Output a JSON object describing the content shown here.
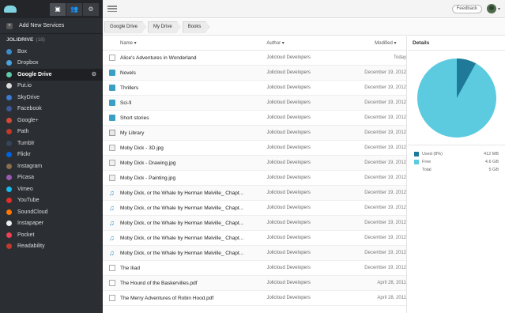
{
  "sidebar": {
    "add_services": "Add New Services",
    "section_title": "JOLIDRIVE",
    "section_count": "(18)",
    "items": [
      {
        "label": "Box",
        "icon": "box-icon",
        "color": "#3b8ec9"
      },
      {
        "label": "Dropbox",
        "icon": "dropbox-icon",
        "color": "#4aa3df"
      },
      {
        "label": "Google Drive",
        "icon": "google-drive-icon",
        "color": "#5fc9a7",
        "active": true
      },
      {
        "label": "Put.io",
        "icon": "putio-icon",
        "color": "#dddddd"
      },
      {
        "label": "SkyDrive",
        "icon": "skydrive-icon",
        "color": "#3a7bd5"
      },
      {
        "label": "Facebook",
        "icon": "facebook-icon",
        "color": "#3b5998"
      },
      {
        "label": "Google+",
        "icon": "google-plus-icon",
        "color": "#d34836"
      },
      {
        "label": "Path",
        "icon": "path-icon",
        "color": "#c0392b"
      },
      {
        "label": "Tumblr",
        "icon": "tumblr-icon",
        "color": "#35465c"
      },
      {
        "label": "Flickr",
        "icon": "flickr-icon",
        "color": "#0063dc"
      },
      {
        "label": "Instagram",
        "icon": "instagram-icon",
        "color": "#8a6d4b"
      },
      {
        "label": "Picasa",
        "icon": "picasa-icon",
        "color": "#9b59b6"
      },
      {
        "label": "Vimeo",
        "icon": "vimeo-icon",
        "color": "#1ab7ea"
      },
      {
        "label": "YouTube",
        "icon": "youtube-icon",
        "color": "#e52d27"
      },
      {
        "label": "SoundCloud",
        "icon": "soundcloud-icon",
        "color": "#ff7700"
      },
      {
        "label": "Instapaper",
        "icon": "instapaper-icon",
        "color": "#eeeeee"
      },
      {
        "label": "Pocket",
        "icon": "pocket-icon",
        "color": "#ee4056"
      },
      {
        "label": "Readability",
        "icon": "readability-icon",
        "color": "#c0392b"
      }
    ]
  },
  "topbar": {
    "feedback": "Feedback"
  },
  "breadcrumb": [
    "Google Drive",
    "My Drive",
    "Books"
  ],
  "columns": {
    "name": "Name",
    "author": "Author",
    "modified": "Modified"
  },
  "files": [
    {
      "type": "file",
      "name": "Alice's Adventures in Wonderland",
      "author": "Jolicloud Developers",
      "modified": "Today"
    },
    {
      "type": "folder",
      "name": "Novels",
      "author": "Jolicloud Developers",
      "modified": "December 19, 2012"
    },
    {
      "type": "folder",
      "name": "Thrillers",
      "author": "Jolicloud Developers",
      "modified": "December 19, 2012"
    },
    {
      "type": "folder",
      "name": "Sci-fi",
      "author": "Jolicloud Developers",
      "modified": "December 19, 2012"
    },
    {
      "type": "folder",
      "name": "Short stories",
      "author": "Jolicloud Developers",
      "modified": "December 19, 2012"
    },
    {
      "type": "lib",
      "name": "My Library",
      "author": "Jolicloud Developers",
      "modified": "December 19, 2012"
    },
    {
      "type": "img",
      "name": "Moby Dick - 3D.jpg",
      "author": "Jolicloud Developers",
      "modified": "December 19, 2012"
    },
    {
      "type": "img",
      "name": "Moby Dick - Drawing.jpg",
      "author": "Jolicloud Developers",
      "modified": "December 19, 2012"
    },
    {
      "type": "img",
      "name": "Moby Dick - Painting.jpg",
      "author": "Jolicloud Developers",
      "modified": "December 19, 2012"
    },
    {
      "type": "audio",
      "name": "Moby Dick, or the Whale by Herman Melville_ Chapt...",
      "author": "Jolicloud Developers",
      "modified": "December 19, 2012"
    },
    {
      "type": "audio",
      "name": "Moby Dick, or the Whale by Herman Melville_ Chapt...",
      "author": "Jolicloud Developers",
      "modified": "December 19, 2012"
    },
    {
      "type": "audio",
      "name": "Moby Dick, or the Whale by Herman Melville_ Chapt...",
      "author": "Jolicloud Developers",
      "modified": "December 19, 2012"
    },
    {
      "type": "audio",
      "name": "Moby Dick, or the Whale by Herman Melville_ Chapt...",
      "author": "Jolicloud Developers",
      "modified": "December 19, 2012"
    },
    {
      "type": "audio",
      "name": "Moby Dick, or the Whale by Herman Melville_ Chapt...",
      "author": "Jolicloud Developers",
      "modified": "December 19, 2012"
    },
    {
      "type": "file",
      "name": "The Iliad",
      "author": "Jolicloud Developers",
      "modified": "December 19, 2012"
    },
    {
      "type": "file",
      "name": "The Hound of the Baskervilles.pdf",
      "author": "Jolicloud Developers",
      "modified": "April 28, 2011"
    },
    {
      "type": "file",
      "name": "The Merry Adventures of Robin Hood.pdf",
      "author": "Jolicloud Developers",
      "modified": "April 28, 2011"
    }
  ],
  "details": {
    "title": "Details",
    "used_label": "Used (8%)",
    "used_value": "412 MB",
    "free_label": "Free",
    "free_value": "4.6 GB",
    "total_label": "Total",
    "total_value": "5 GB",
    "used_fraction": 0.08,
    "used_color": "#1f7a99",
    "free_color": "#5ccbe0"
  }
}
